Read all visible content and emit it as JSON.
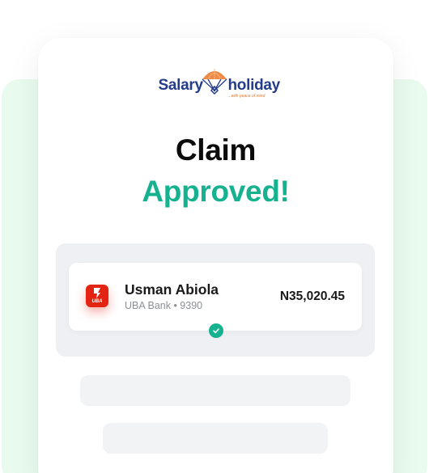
{
  "brand": {
    "name_left": "Salary",
    "name_right": "holiday",
    "tagline": "...with peace of mind",
    "primary_color": "#253c8a",
    "accent_color": "#e0782a",
    "icon": "parachute-icon"
  },
  "status": {
    "title_line1": "Claim",
    "title_line2": "Approved!",
    "success_color": "#16b28f"
  },
  "account": {
    "bank_logo_icon": "uba-bank-icon",
    "bank_logo_text": "UBA",
    "name": "Usman Abiola",
    "bank_detail": "UBA Bank • 9390",
    "amount": "N35,020.45",
    "verified_icon": "check-circle-icon"
  },
  "colors": {
    "background_panel": "#e9fbee",
    "bank_red": "#e32412"
  }
}
